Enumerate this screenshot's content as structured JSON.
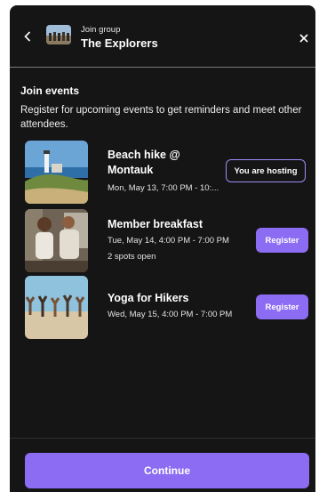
{
  "header": {
    "subtitle": "Join group",
    "title": "The Explorers",
    "back_icon": "chevron-left-icon",
    "close_icon": "close-icon"
  },
  "section": {
    "title": "Join events",
    "description": "Register for upcoming events to get reminders and meet other attendees."
  },
  "events": [
    {
      "title": "Beach hike @ Montauk",
      "datetime": "Mon, May 13, 7:00 PM - 10:...",
      "spots": "",
      "action_label": "You are hosting",
      "action_style": "outline"
    },
    {
      "title": "Member breakfast",
      "datetime": "Tue, May 14, 4:00 PM - 7:00 PM",
      "spots": "2 spots open",
      "action_label": "Register",
      "action_style": "filled"
    },
    {
      "title": "Yoga for Hikers",
      "datetime": "Wed, May 15, 4:00 PM - 7:00 PM",
      "spots": "",
      "action_label": "Register",
      "action_style": "filled"
    }
  ],
  "footer": {
    "continue_label": "Continue"
  },
  "colors": {
    "background": "#151515",
    "accent": "#8c6cf3",
    "accent_border": "#9b8cf5",
    "text": "#ffffff"
  }
}
